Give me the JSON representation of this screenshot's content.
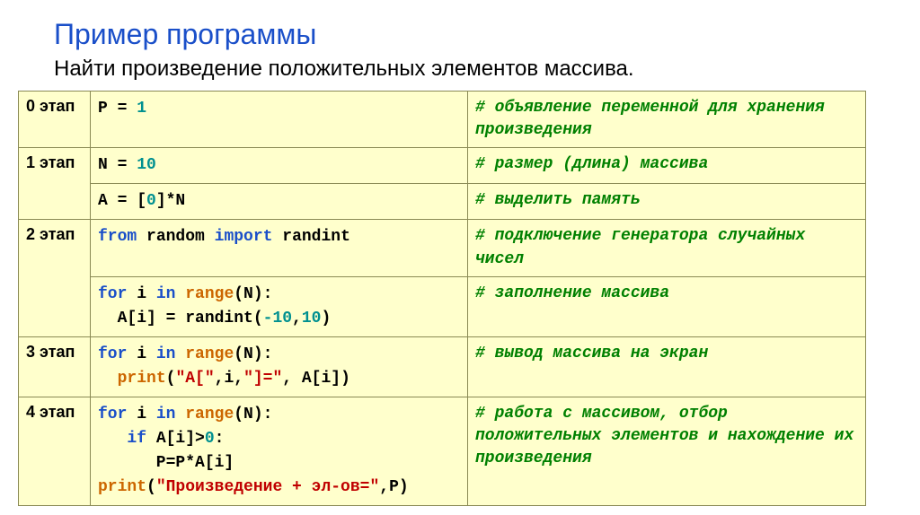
{
  "title": "Пример программы",
  "subtitle": "Найти  произведение положительных элементов массива.",
  "rows": [
    {
      "stage": "0 этап",
      "code": [
        {
          "parts": [
            {
              "t": "P = ",
              "c": "c-black"
            },
            {
              "t": "1",
              "c": "c-teal"
            }
          ]
        }
      ],
      "comment": "# объявление переменной для хранения произведения",
      "rowspan": 1
    },
    {
      "stage": "1 этап",
      "code": [
        {
          "parts": [
            {
              "t": "N = ",
              "c": "c-black"
            },
            {
              "t": "10",
              "c": "c-teal"
            }
          ]
        }
      ],
      "comment": "# размер (длина) массива",
      "rowspan": 2
    },
    {
      "stage": "",
      "code": [
        {
          "parts": [
            {
              "t": "A = [",
              "c": "c-black"
            },
            {
              "t": "0",
              "c": "c-teal"
            },
            {
              "t": "]*N",
              "c": "c-black"
            }
          ]
        }
      ],
      "comment": "# выделить память",
      "rowspan": 0
    },
    {
      "stage": "2 этап",
      "code": [
        {
          "parts": [
            {
              "t": "from ",
              "c": "c-blue"
            },
            {
              "t": "random ",
              "c": "c-black"
            },
            {
              "t": "import ",
              "c": "c-blue"
            },
            {
              "t": "randint",
              "c": "c-black"
            }
          ]
        }
      ],
      "comment": "# подключение генератора случайных чисел",
      "rowspan": 2
    },
    {
      "stage": "",
      "code": [
        {
          "parts": [
            {
              "t": "for ",
              "c": "c-blue"
            },
            {
              "t": "i ",
              "c": "c-black"
            },
            {
              "t": "in ",
              "c": "c-blue"
            },
            {
              "t": "range",
              "c": "c-orange"
            },
            {
              "t": "(N):",
              "c": "c-black"
            }
          ]
        },
        {
          "parts": [
            {
              "t": "  A[i] = randint(",
              "c": "c-black"
            },
            {
              "t": "-10",
              "c": "c-teal"
            },
            {
              "t": ",",
              "c": "c-black"
            },
            {
              "t": "10",
              "c": "c-teal"
            },
            {
              "t": ")",
              "c": "c-black"
            }
          ]
        }
      ],
      "comment": "# заполнение массива",
      "rowspan": 0
    },
    {
      "stage": "3 этап",
      "code": [
        {
          "parts": [
            {
              "t": "for ",
              "c": "c-blue"
            },
            {
              "t": "i ",
              "c": "c-black"
            },
            {
              "t": "in ",
              "c": "c-blue"
            },
            {
              "t": "range",
              "c": "c-orange"
            },
            {
              "t": "(N):",
              "c": "c-black"
            }
          ]
        },
        {
          "parts": [
            {
              "t": "  ",
              "c": "c-black"
            },
            {
              "t": "print",
              "c": "c-orange"
            },
            {
              "t": "(",
              "c": "c-black"
            },
            {
              "t": "\"A[\"",
              "c": "c-red"
            },
            {
              "t": ",i,",
              "c": "c-black"
            },
            {
              "t": "\"]=\"",
              "c": "c-red"
            },
            {
              "t": ", A[i])",
              "c": "c-black"
            }
          ]
        }
      ],
      "comment": "# вывод массива на экран",
      "rowspan": 1
    },
    {
      "stage": "4 этап",
      "code": [
        {
          "parts": [
            {
              "t": "for ",
              "c": "c-blue"
            },
            {
              "t": "i ",
              "c": "c-black"
            },
            {
              "t": "in ",
              "c": "c-blue"
            },
            {
              "t": "range",
              "c": "c-orange"
            },
            {
              "t": "(N):",
              "c": "c-black"
            }
          ]
        },
        {
          "parts": [
            {
              "t": "   ",
              "c": "c-black"
            },
            {
              "t": "if ",
              "c": "c-blue"
            },
            {
              "t": "A[i]>",
              "c": "c-black"
            },
            {
              "t": "0",
              "c": "c-teal"
            },
            {
              "t": ":",
              "c": "c-black"
            }
          ]
        },
        {
          "parts": [
            {
              "t": "      P=P*A[i]",
              "c": "c-black"
            }
          ]
        },
        {
          "parts": [
            {
              "t": "print",
              "c": "c-orange"
            },
            {
              "t": "(",
              "c": "c-black"
            },
            {
              "t": "\"Произведение + эл-ов=\"",
              "c": "c-red"
            },
            {
              "t": ",P)",
              "c": "c-black"
            }
          ]
        }
      ],
      "comment": "# работа с массивом, отбор положительных элементов и нахождение их произведения",
      "rowspan": 1
    }
  ]
}
